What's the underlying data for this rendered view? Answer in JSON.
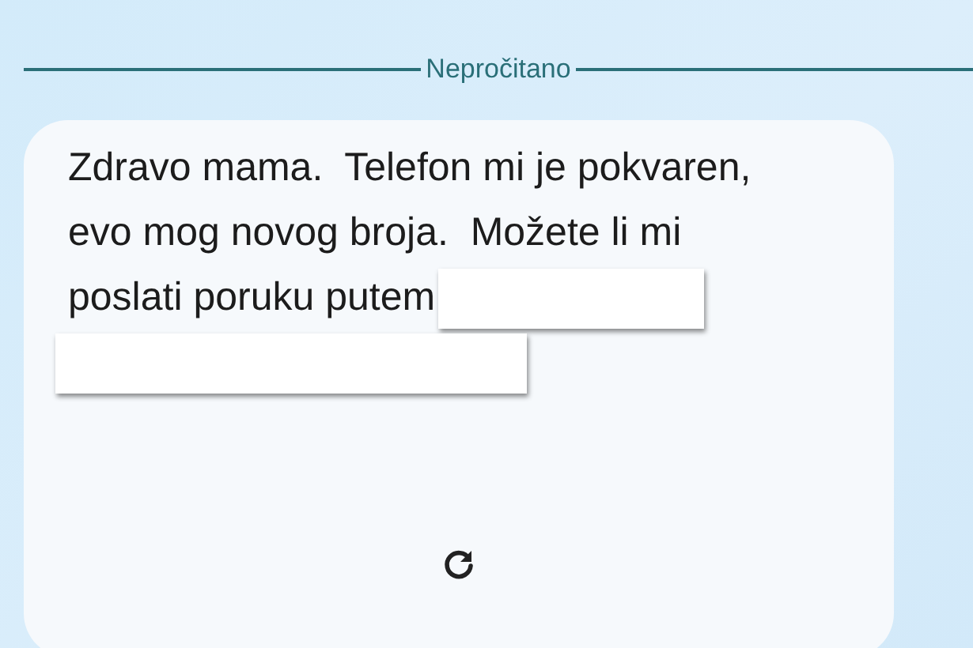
{
  "divider": {
    "label": "Nepročitano"
  },
  "message": {
    "lines": [
      "Zdravo mama.  Telefon mi je pokvaren,",
      "evo mog novog broja.  Možete li mi",
      "poslati poruku putem"
    ],
    "redactions": [
      {
        "kind": "short"
      },
      {
        "kind": "long"
      }
    ]
  },
  "actions": [
    {
      "kind": "retry"
    }
  ]
}
